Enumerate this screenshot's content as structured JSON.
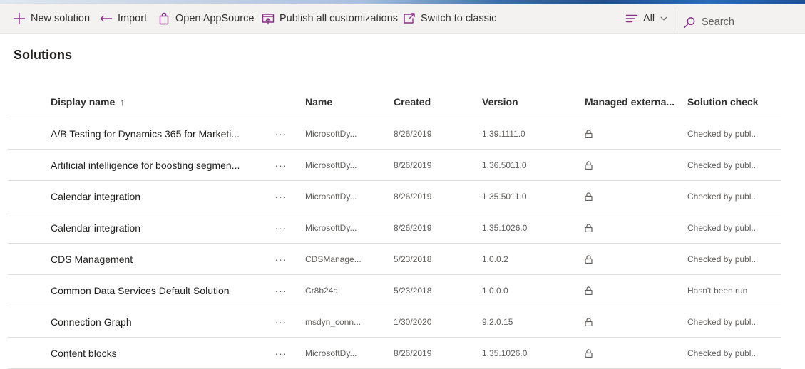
{
  "command_bar": {
    "new_solution": "New solution",
    "import": "Import",
    "open_appsource": "Open AppSource",
    "publish_all": "Publish all customizations",
    "switch_classic": "Switch to classic",
    "filter_label": "All",
    "search_placeholder": "Search"
  },
  "page": {
    "title": "Solutions"
  },
  "table": {
    "headers": {
      "display_name": "Display name",
      "sort_indicator": "↑",
      "name": "Name",
      "created": "Created",
      "version": "Version",
      "managed": "Managed externa...",
      "solution_check": "Solution check"
    },
    "more_glyph": "···",
    "rows": [
      {
        "display_name": "A/B Testing for Dynamics 365 for Marketi...",
        "name": "MicrosoftDy...",
        "created": "8/26/2019",
        "version": "1.39.1111.0",
        "solution_check": "Checked by publ..."
      },
      {
        "display_name": "Artificial intelligence for boosting segmen...",
        "name": "MicrosoftDy...",
        "created": "8/26/2019",
        "version": "1.36.5011.0",
        "solution_check": "Checked by publ..."
      },
      {
        "display_name": "Calendar integration",
        "name": "MicrosoftDy...",
        "created": "8/26/2019",
        "version": "1.35.5011.0",
        "solution_check": "Checked by publ..."
      },
      {
        "display_name": "Calendar integration",
        "name": "MicrosoftDy...",
        "created": "8/26/2019",
        "version": "1.35.1026.0",
        "solution_check": "Checked by publ..."
      },
      {
        "display_name": "CDS Management",
        "name": "CDSManage...",
        "created": "5/23/2018",
        "version": "1.0.0.2",
        "solution_check": "Checked by publ..."
      },
      {
        "display_name": "Common Data Services Default Solution",
        "name": "Cr8b24a",
        "created": "5/23/2018",
        "version": "1.0.0.0",
        "solution_check": "Hasn't been run"
      },
      {
        "display_name": "Connection Graph",
        "name": "msdyn_conn...",
        "created": "1/30/2020",
        "version": "9.2.0.15",
        "solution_check": "Checked by publ..."
      },
      {
        "display_name": "Content blocks",
        "name": "MicrosoftDy...",
        "created": "8/26/2019",
        "version": "1.35.1026.0",
        "solution_check": "Checked by publ..."
      }
    ]
  },
  "colors": {
    "accent": "#8a2f88",
    "command_bar_bg": "#f3f2f1",
    "row_border": "#e1dfdd"
  },
  "icons": [
    "plus-icon",
    "import-icon",
    "appsource-bag-icon",
    "publish-icon",
    "switch-classic-icon",
    "filter-lines-icon",
    "chevron-down-icon",
    "search-icon",
    "lock-icon"
  ]
}
